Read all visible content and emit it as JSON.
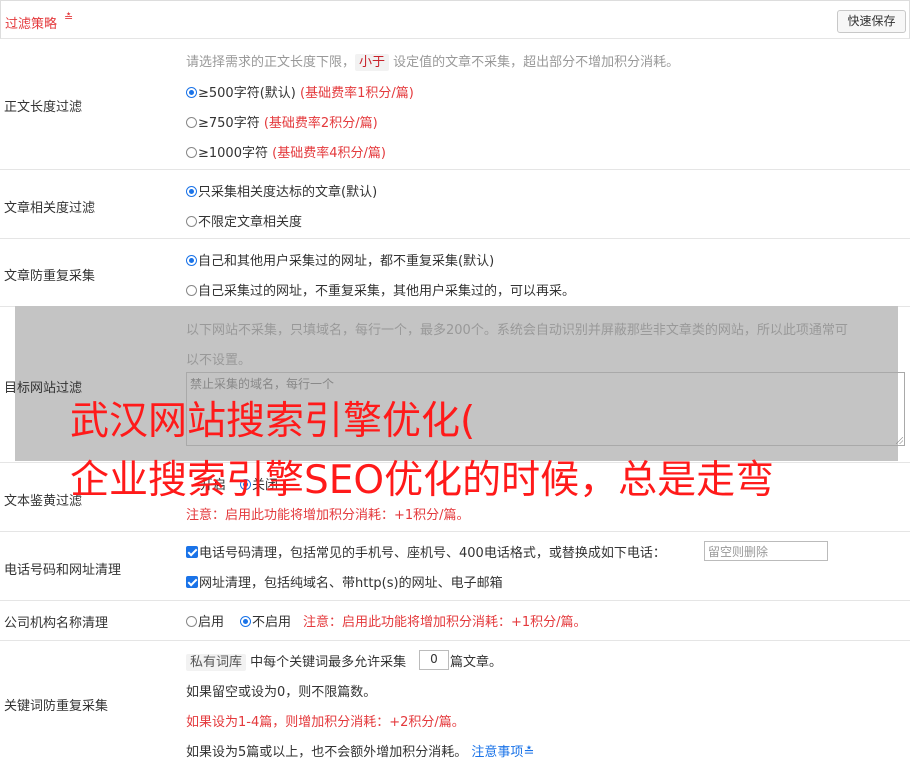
{
  "header": {
    "title": "过滤策略",
    "save_label": "快速保存"
  },
  "length_filter": {
    "label": "正文长度过滤",
    "desc_before": "请选择需求的正文长度下限，",
    "desc_chip": "小于",
    "desc_after": "设定值的文章不采集，超出部分不增加积分消耗。",
    "options": [
      {
        "text": "≥500字符(默认)",
        "note": "(基础费率1积分/篇)"
      },
      {
        "text": "≥750字符",
        "note": "(基础费率2积分/篇)"
      },
      {
        "text": "≥1000字符",
        "note": "(基础费率4积分/篇)"
      }
    ]
  },
  "relevance": {
    "label": "文章相关度过滤",
    "options": [
      "只采集相关度达标的文章(默认)",
      "不限定文章相关度"
    ]
  },
  "dedupe": {
    "label": "文章防重复采集",
    "options": [
      "自己和其他用户采集过的网址，都不重复采集(默认)",
      "自己采集过的网址，不重复采集，其他用户采集过的，可以再采。"
    ]
  },
  "site_filter": {
    "label": "目标网站过滤",
    "desc_line1": "以下网站不采集，只填域名，每行一个，最多200个。系统会自动识别并屏蔽那些非文章类的网站，所以此项通常可",
    "desc_line2": "以不设置。",
    "placeholder": "禁止采集的域名，每行一个"
  },
  "porn_filter": {
    "label": "文本鉴黄过滤",
    "line_a": "开启",
    "line_b": "关闭",
    "note": "注意：启用此功能将增加积分消耗：+1积分/篇。"
  },
  "phone_clean": {
    "label": "电话号码和网址清理",
    "phone_text": "电话号码清理，包括常见的手机号、座机号、400电话格式，或替换成如下电话：",
    "phone_placeholder": "留空则删除",
    "url_text": "网址清理，包括纯域名、带http(s)的网址、电子邮箱"
  },
  "company_clean": {
    "label": "公司机构名称清理",
    "on": "启用",
    "off": "不启用",
    "note": "注意：启用此功能将增加积分消耗：+1积分/篇。"
  },
  "keyword_dedupe": {
    "label": "关键词防重复采集",
    "chip": "私有词库",
    "text_before": "中每个关键词最多允许采集",
    "value": "0",
    "text_after": "篇文章。",
    "line2": "如果留空或设为0，则不限篇数。",
    "line3": "如果设为1-4篇，则增加积分消耗：+2积分/篇。",
    "line4": "如果设为5篇或以上，也不会额外增加积分消耗。",
    "link": "注意事项"
  },
  "overlay": {
    "headline1": "武汉网站搜索引擎优化(",
    "headline2": "企业搜索引擎SEO优化的时候，总是走弯"
  }
}
